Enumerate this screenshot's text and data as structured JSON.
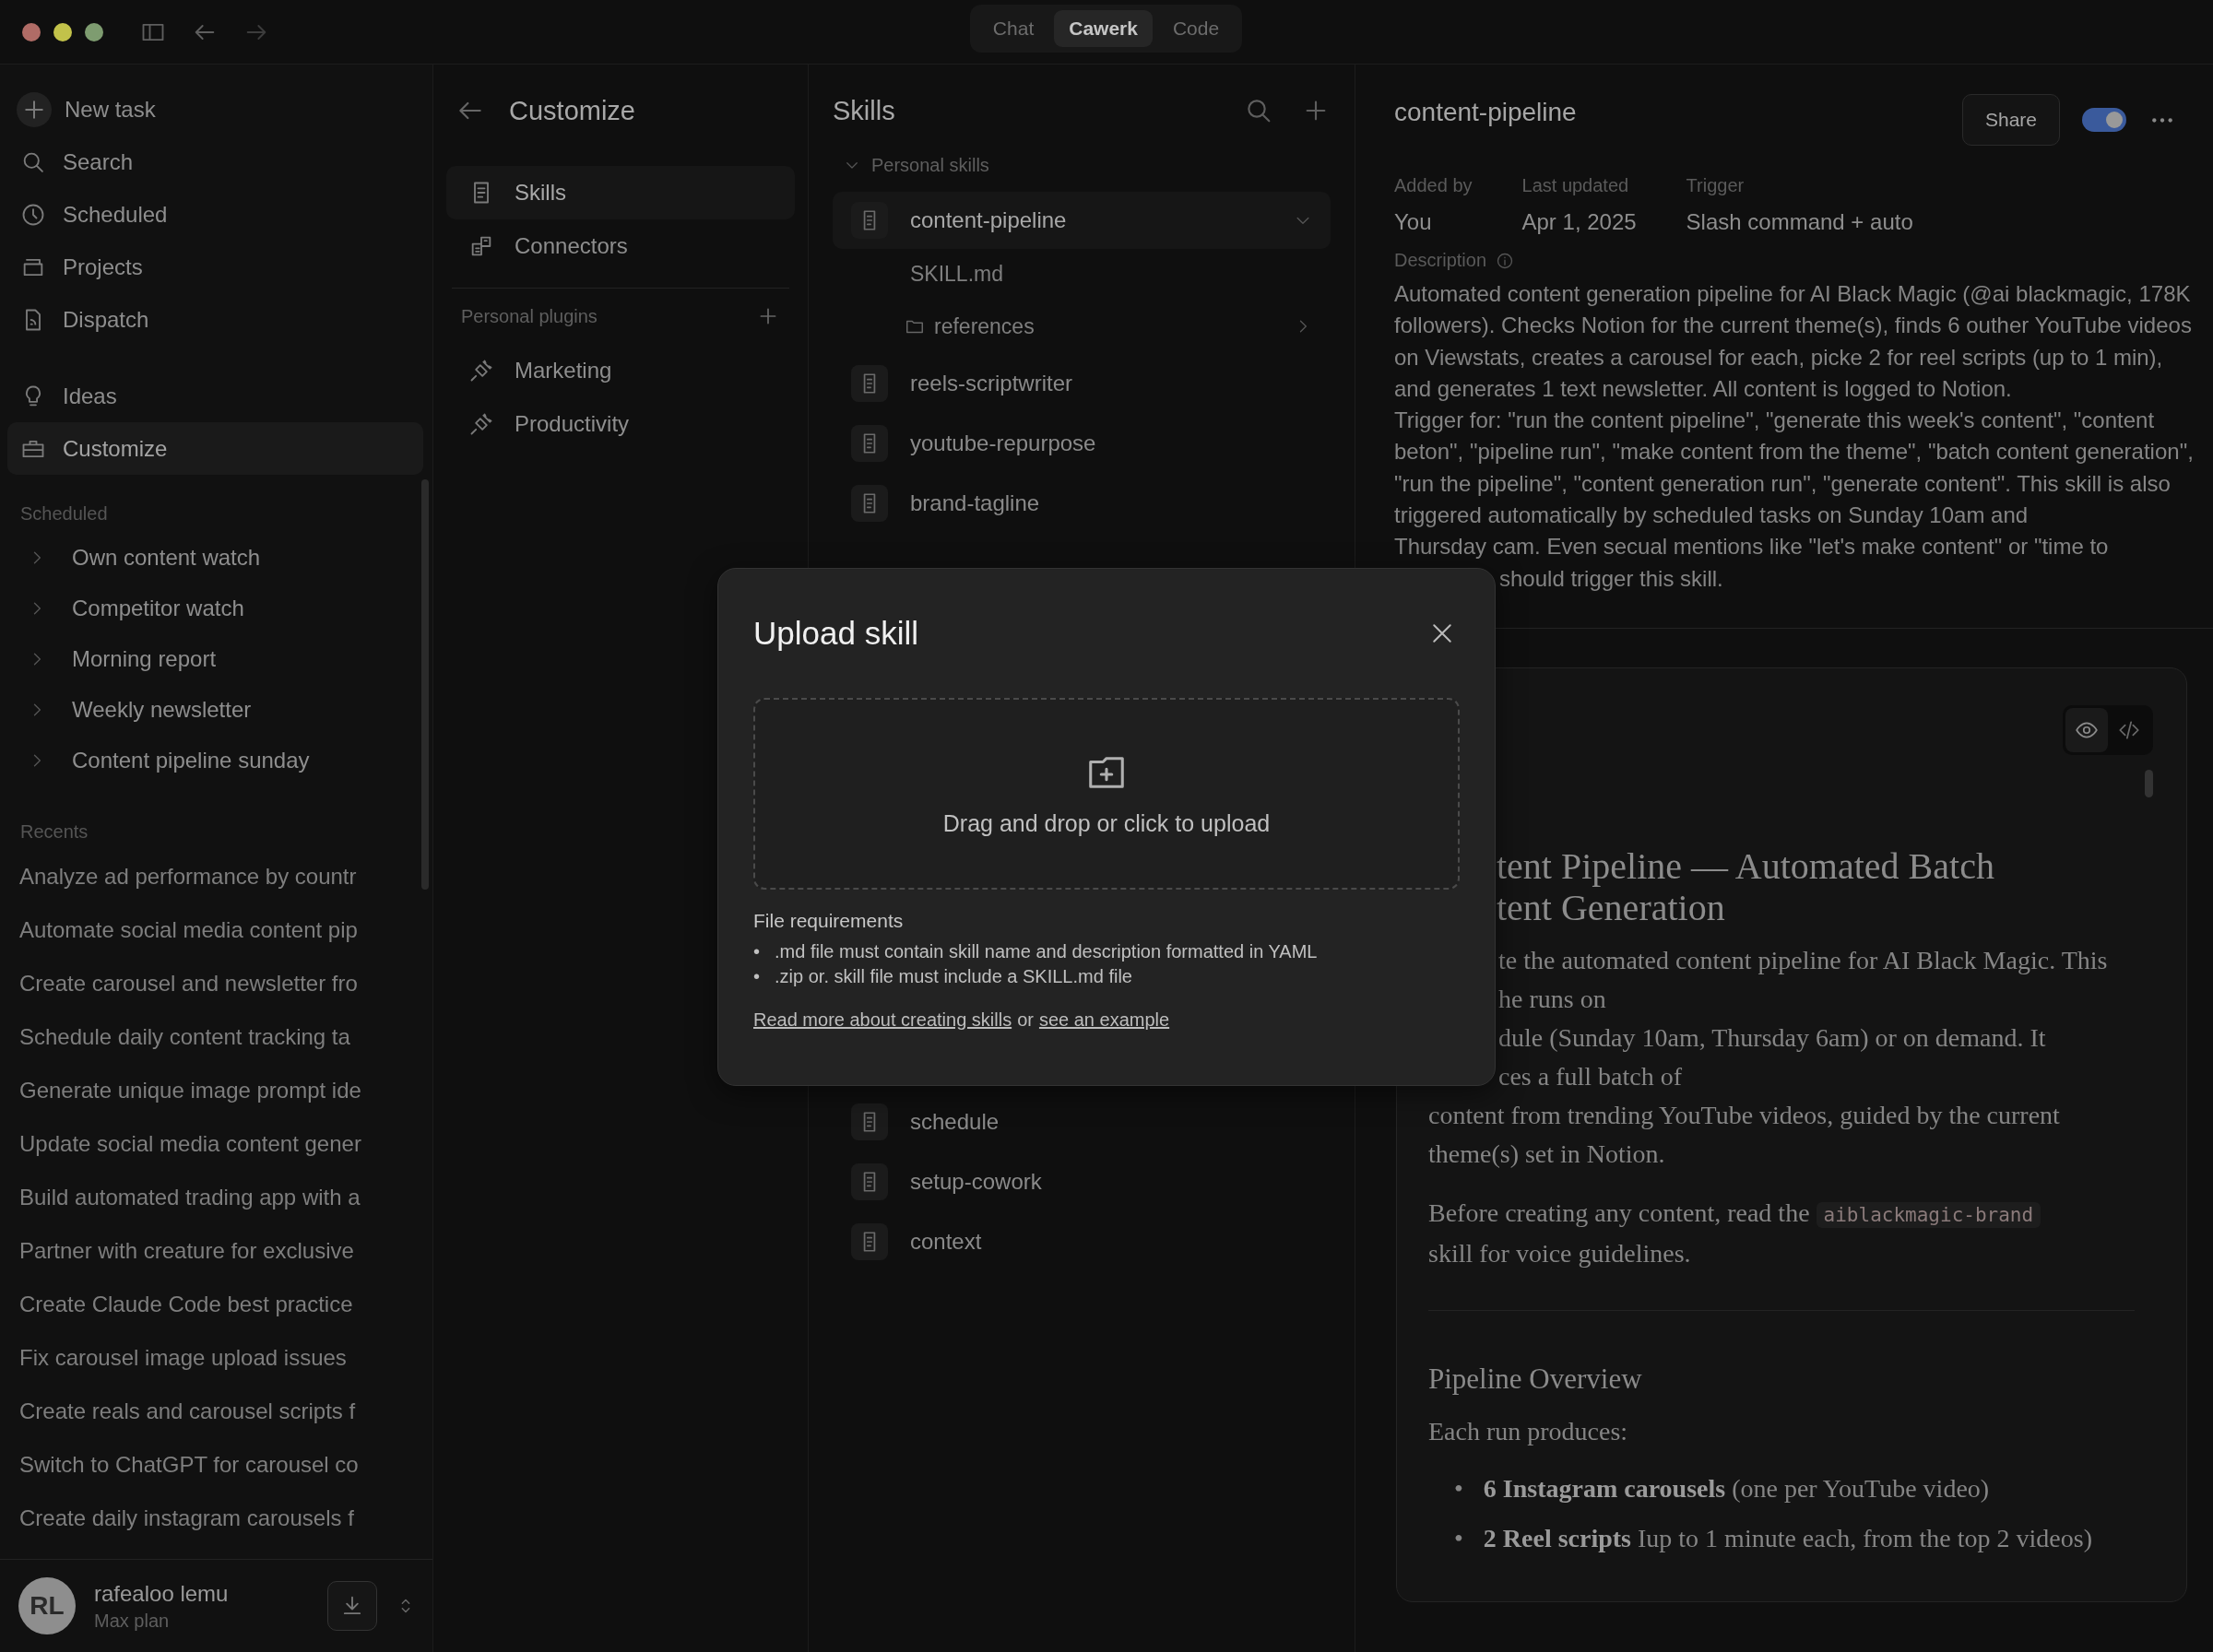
{
  "window": {
    "tabs": [
      {
        "label": "Chat",
        "selected": false
      },
      {
        "label": "Cawerk",
        "selected": true
      },
      {
        "label": "Code",
        "selected": false
      }
    ]
  },
  "sidebar": {
    "nav": [
      {
        "label": "New task",
        "selected": false
      },
      {
        "label": "Search",
        "selected": false
      },
      {
        "label": "Scheduled",
        "selected": false
      },
      {
        "label": "Projects",
        "selected": false
      },
      {
        "label": "Dispatch",
        "selected": false
      }
    ],
    "nav_more": [
      {
        "label": "Ideas",
        "selected": false
      },
      {
        "label": "Customize",
        "selected": true
      }
    ],
    "scheduled_heading": "Scheduled",
    "scheduled": [
      "Own content watch",
      "Competitor watch",
      "Morning report",
      "Weekly newsletter",
      "Content pipeline sunday"
    ],
    "recents_heading": "Recents",
    "recents": [
      "Analyze ad performance by countr",
      "Automate social media content pip",
      "Create carousel and newsletter fro",
      "Schedule daily content tracking ta",
      "Generate unique image prompt ide",
      "Update social media content gener",
      "Build automated trading app with a",
      "Partner with creature for exclusive",
      "Create Claude Code best practice",
      "Fix carousel image upload issues",
      "Create reals and carousel scripts f",
      "Switch to ChatGPT for carousel co",
      "Create daily instagram carousels f"
    ],
    "user": {
      "initials": "RL",
      "name": "rafealoo lemu",
      "plan": "Max plan"
    }
  },
  "customize": {
    "title": "Customize",
    "items": [
      {
        "label": "Skills",
        "selected": true
      },
      {
        "label": "Connectors",
        "selected": false
      }
    ],
    "plugins_heading": "Personal plugins",
    "plugins": [
      "Marketing",
      "Productivity"
    ]
  },
  "skills": {
    "title": "Skills",
    "group": {
      "label": "Personal skills",
      "expanded": true
    },
    "items": [
      {
        "name": "content-pipeline",
        "selected": true,
        "children": [
          {
            "kind": "file",
            "name": "SKILL.md"
          },
          {
            "kind": "folder",
            "name": "references"
          }
        ]
      },
      {
        "name": "reels-scriptwriter",
        "selected": false
      },
      {
        "name": "youtube-repurpose",
        "selected": false
      },
      {
        "name": "brand-tagline",
        "selected": false
      }
    ],
    "items_below_dialog": [
      {
        "name": "schedule",
        "selected": false
      },
      {
        "name": "setup-cowork",
        "selected": false
      },
      {
        "name": "context",
        "selected": false
      }
    ]
  },
  "detail": {
    "title": "content-pipeline",
    "share": "Share",
    "enabled": true,
    "meta": [
      {
        "label": "Added by",
        "value": "You"
      },
      {
        "label": "Last updated",
        "value": "Apr 1, 2025"
      },
      {
        "label": "Trigger",
        "value": "Slash command + auto"
      }
    ],
    "description_label": "Description",
    "description": [
      "Automated content generation pipeline for AI Black Magic (@ai blackmagic, 178K followers). Checks Notion for the current theme(s), finds 6 outher YouTube videos on Viewstats, creates a carousel for each, picke 2 for reel scripts (up to 1 min), and generates 1 text newsletter. All content is logged to Notion.",
      "Trigger for: \"run the content pipeline\", \"generate this week's content\", \"content beton\", \"pipeline run\", \"make content from the theme\", \"batch content generation\", \"run the pipeline\", \"content generation run\", \"generate content\". This skill is also triggered automatically by scheduled tasks on Sunday 10am and",
      "Thursday cam. Even secual mentions like \"let's make content\" or \"time to"
    ],
    "description_tail": "should trigger this skill.",
    "document": {
      "view_modes": [
        {
          "kind": "preview",
          "selected": true
        },
        {
          "kind": "code",
          "selected": false
        }
      ],
      "heading_lines": [
        "tent Pipeline — Automated Batch",
        "tent Generation"
      ],
      "intro_lines": [
        "te the automated content pipeline for AI Black Magic. This",
        "he runs on",
        "dule (Sunday 10am, Thursday 6am) or on demand. It",
        "ces a full batch of"
      ],
      "intro_rest": "content from trending YouTube videos, guided by the current theme(s) set in Notion.",
      "note_before": "Before creating any content, read the",
      "note_code": "aiblackmagic-brand",
      "note_after": "skill for voice guidelines.",
      "section_heading": "Pipeline Overview",
      "lead": "Each run produces:",
      "bullet_marker": "•",
      "bullets": [
        "**6 Instagram carousels** (one per YouTube video)",
        "**2 Reel scripts** Iup to 1 minute each, from the top 2 videos)"
      ]
    }
  },
  "dialog": {
    "title": "Upload skill",
    "dropzone": "Drag and drop or click to upload",
    "requirements_heading": "File requirements",
    "bullet_marker": "•",
    "requirements": [
      ".md file must contain skill name and description formatted in YAML",
      ".zip or. skill file must include a SKILL.md file"
    ],
    "links": [
      "Read more about creating skills",
      "see an example"
    ],
    "link_joiner": "or"
  }
}
